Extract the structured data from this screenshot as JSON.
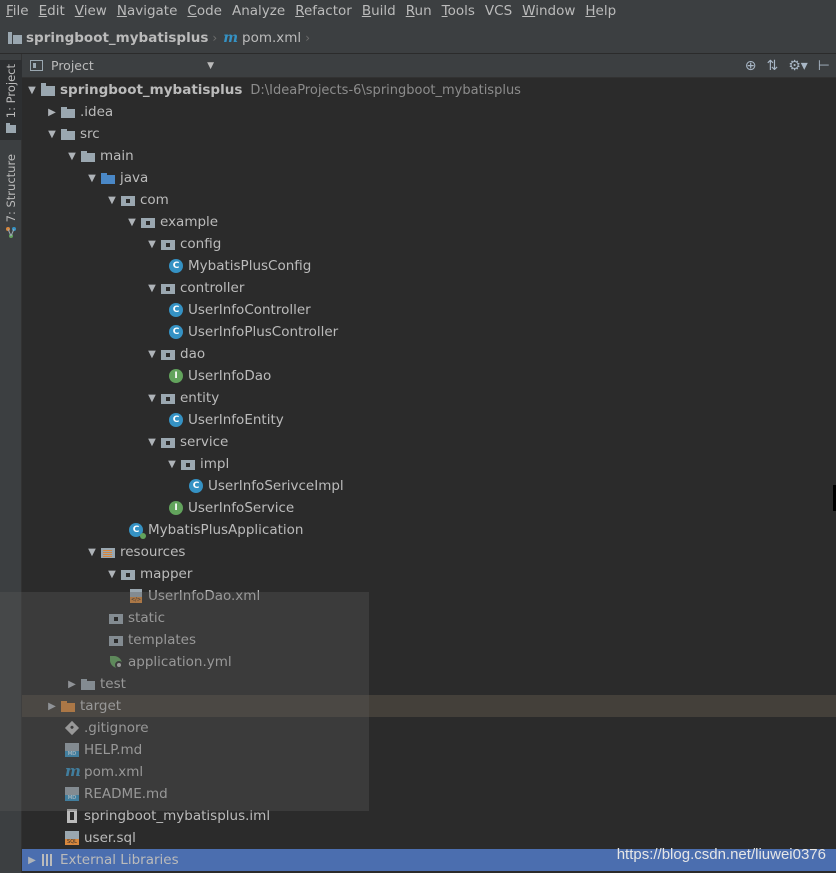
{
  "menubar": {
    "items": [
      {
        "u": "F",
        "rest": "ile"
      },
      {
        "u": "E",
        "rest": "dit"
      },
      {
        "u": "V",
        "rest": "iew"
      },
      {
        "u": "N",
        "rest": "avigate"
      },
      {
        "u": "C",
        "rest": "ode"
      },
      {
        "u": "",
        "rest": "Analyze"
      },
      {
        "u": "R",
        "rest": "efactor"
      },
      {
        "u": "B",
        "rest": "uild"
      },
      {
        "u": "R",
        "rest": "un"
      },
      {
        "u": "T",
        "rest": "ools"
      },
      {
        "u": "",
        "rest": "VCS"
      },
      {
        "u": "W",
        "rest": "indow"
      },
      {
        "u": "H",
        "rest": "elp"
      }
    ]
  },
  "breadcrumb": {
    "project": "springboot_mybatisplus",
    "file": "pom.xml"
  },
  "leftstrip": {
    "project_tab": "1: Project",
    "structure_tab": "7: Structure"
  },
  "toolwindow": {
    "view": "Project"
  },
  "tree": {
    "root_label": "springboot_mybatisplus",
    "root_path": "D:\\IdeaProjects-6\\springboot_mybatisplus",
    "idea": ".idea",
    "src": "src",
    "main": "main",
    "java": "java",
    "com": "com",
    "example": "example",
    "config": "config",
    "mybatis_plus_config": "MybatisPlusConfig",
    "controller": "controller",
    "user_info_controller": "UserInfoController",
    "user_info_plus_controller": "UserInfoPlusController",
    "dao": "dao",
    "user_info_dao": "UserInfoDao",
    "entity": "entity",
    "user_info_entity": "UserInfoEntity",
    "service": "service",
    "impl": "impl",
    "user_info_service_impl": "UserInfoSerivceImpl",
    "user_info_service": "UserInfoService",
    "application_class": "MybatisPlusApplication",
    "resources": "resources",
    "mapper": "mapper",
    "user_info_dao_xml": "UserInfoDao.xml",
    "static": "static",
    "templates": "templates",
    "application_yml": "application.yml",
    "test": "test",
    "target": "target",
    "gitignore": ".gitignore",
    "help_md": "HELP.md",
    "pom_xml": "pom.xml",
    "readme_md": "README.md",
    "iml": "springboot_mybatisplus.iml",
    "user_sql": "user.sql",
    "external_libraries": "External Libraries"
  },
  "watermark": "https://blog.csdn.net/liuwei0376",
  "colors": {
    "background": "#2b2b2b",
    "panel": "#3c3f41",
    "class_icon": "#3592c4",
    "interface_icon": "#62a35c",
    "excluded_folder": "#d8873d",
    "selection": "#4b6eaf"
  }
}
